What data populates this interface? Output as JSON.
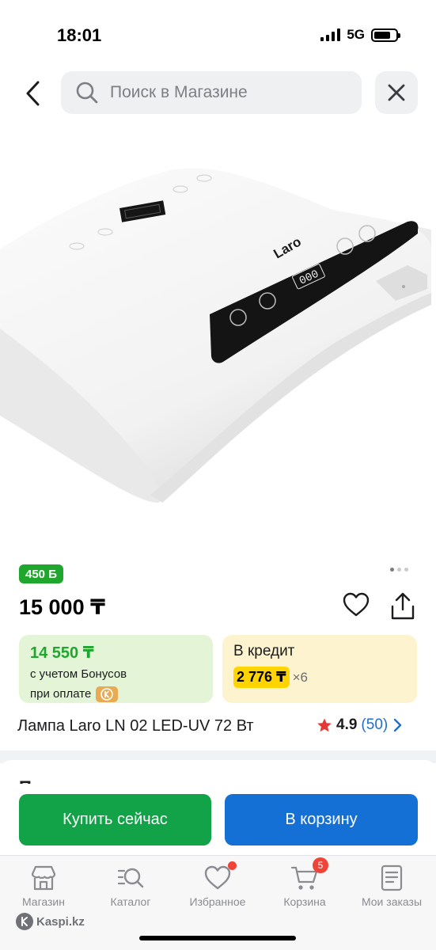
{
  "status_bar": {
    "time": "18:01",
    "network": "5G",
    "battery_level": 0.78
  },
  "search": {
    "placeholder": "Поиск в Магазине",
    "value": ""
  },
  "product": {
    "image_brand_text": "Laro",
    "image_counter_text": "000",
    "bonus_badge": "450 Б",
    "gallery_pages": 3,
    "gallery_active_index": 0,
    "price": "15 000 ₸",
    "title": "Лампа Laro LN 02 LED-UV 72 Вт",
    "rating": "4.9",
    "reviews": "(50)"
  },
  "bonus_card": {
    "price": "14 550 ₸",
    "line1": "с учетом Бонусов",
    "line2": "при оплате"
  },
  "credit_card": {
    "title": "В кредит",
    "amount": "2 776 ₸",
    "multiplier": "×6"
  },
  "sellers": {
    "title": "Продавцы"
  },
  "actions": {
    "buy_now": "Купить сейчас",
    "add_to_cart": "В корзину"
  },
  "tabs": [
    {
      "label": "Магазин",
      "icon": "store-icon"
    },
    {
      "label": "Каталог",
      "icon": "catalog-search-icon"
    },
    {
      "label": "Избранное",
      "icon": "heart-icon",
      "dot": true
    },
    {
      "label": "Корзина",
      "icon": "cart-icon",
      "badge": "5"
    },
    {
      "label": "Мои заказы",
      "icon": "orders-icon"
    }
  ],
  "watermark": "Kaspi.kz",
  "colors": {
    "green": "#1ea72c",
    "buy_button": "#12a349",
    "cart_button": "#1570d6",
    "credit_highlight": "#ffd400",
    "badge_red": "#f04438"
  }
}
